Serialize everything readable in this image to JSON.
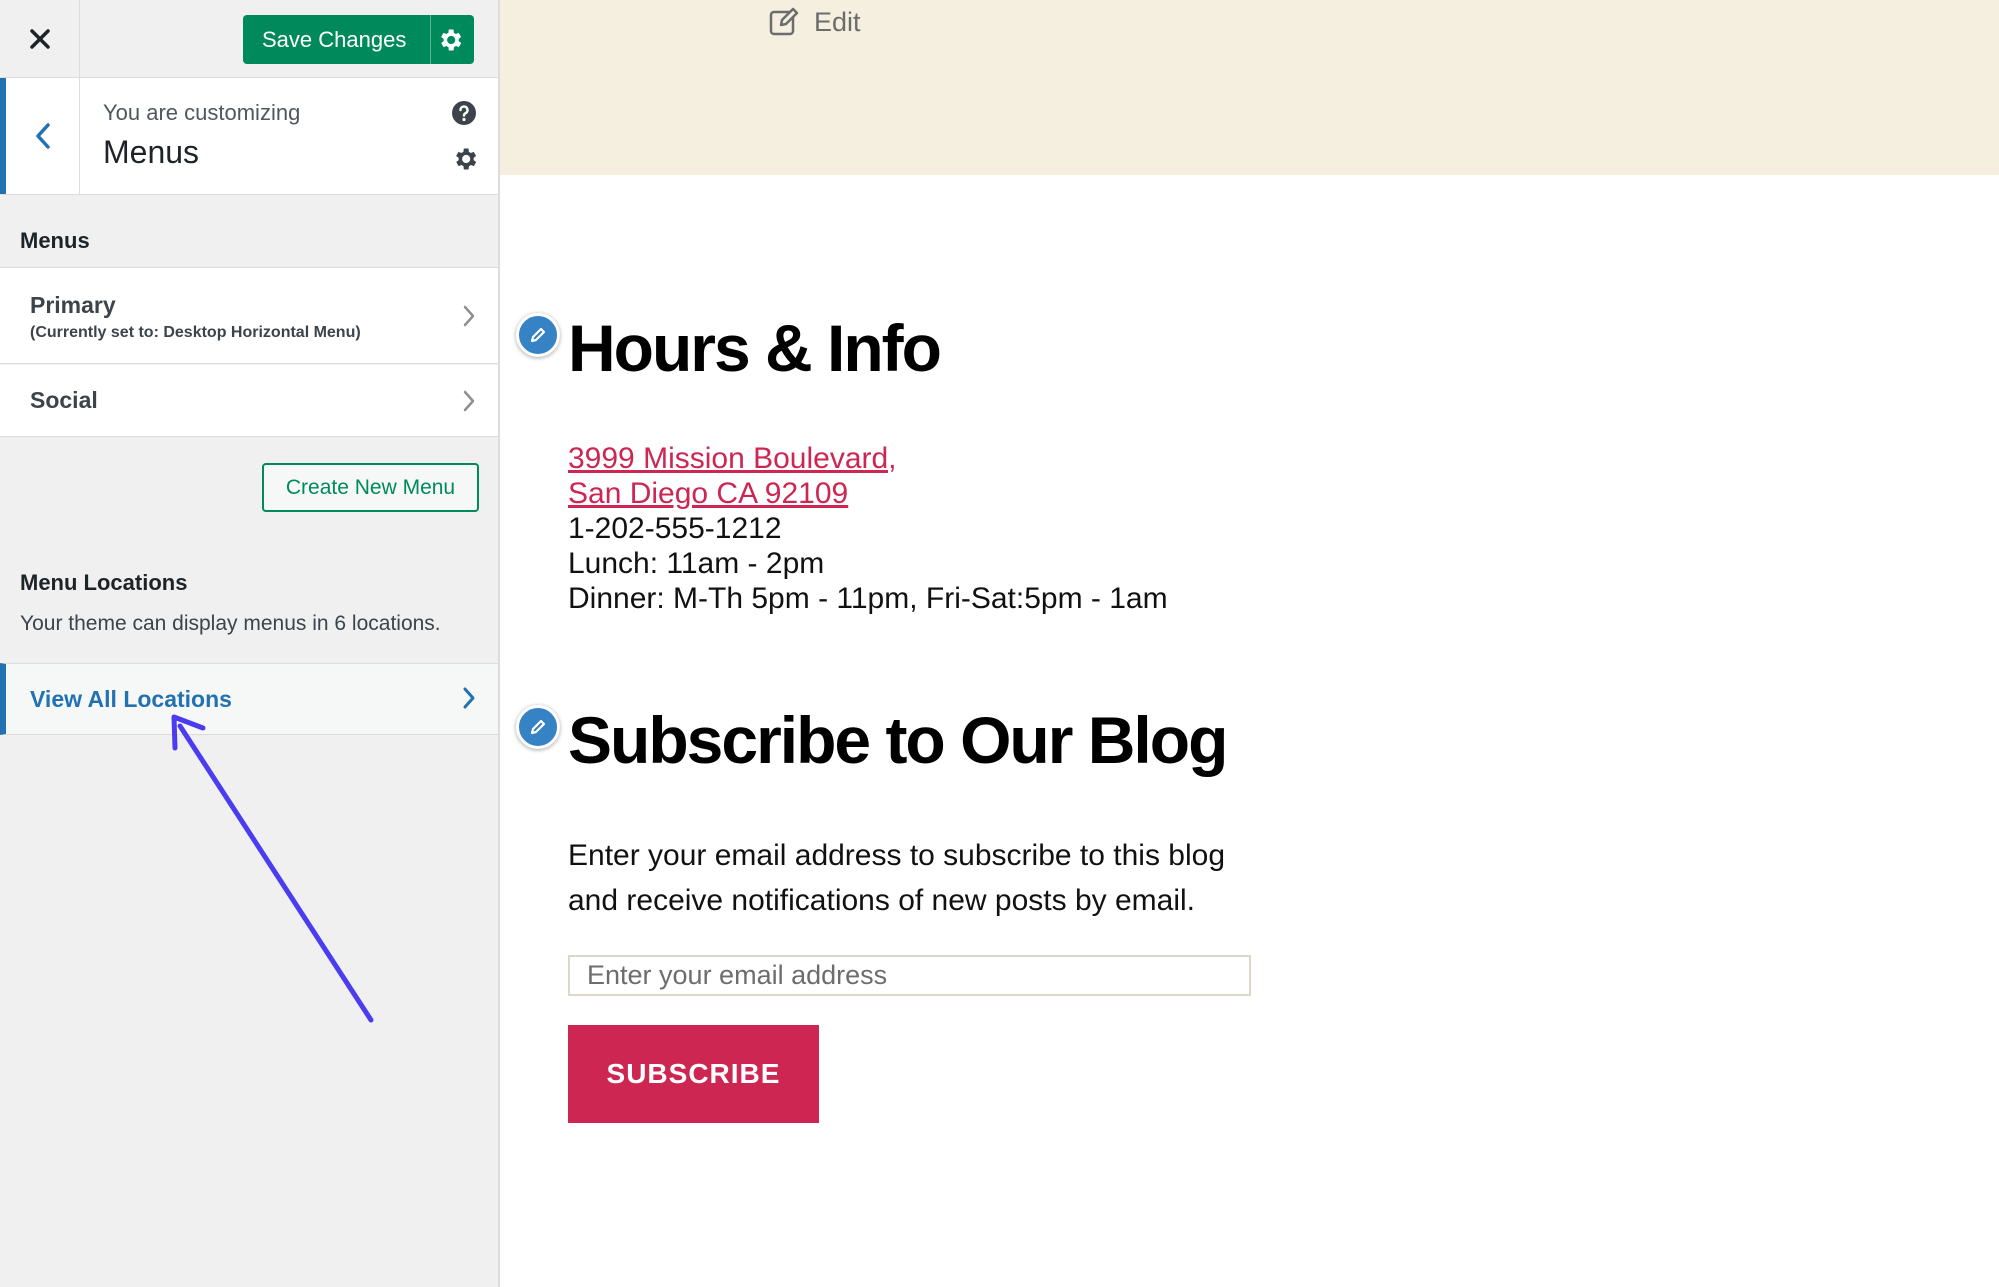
{
  "sidebar": {
    "close_icon": "close-icon",
    "save_label": "Save Changes",
    "customizing": {
      "pre": "You are customizing",
      "title": "Menus"
    },
    "menus_section_title": "Menus",
    "menus": [
      {
        "name": "Primary",
        "sub": "(Currently set to: Desktop Horizontal Menu)"
      },
      {
        "name": "Social",
        "sub": ""
      }
    ],
    "create_label": "Create New Menu",
    "locations_title": "Menu Locations",
    "locations_desc": "Your theme can display menus in 6 locations.",
    "view_all_label": "View All Locations",
    "colors": {
      "accent_green": "#008a5b",
      "accent_blue": "#2271b1",
      "annotation_arrow": "#4b3cf0"
    }
  },
  "preview": {
    "edit_label": "Edit",
    "hours_heading": "Hours & Info",
    "address_line1": "3999 Mission Boulevard,",
    "address_line2": "San Diego CA 92109",
    "phone": "1-202-555-1212",
    "lunch": "Lunch: 11am - 2pm",
    "dinner": "Dinner: M-Th 5pm - 11pm, Fri-Sat:5pm - 1am",
    "subscribe_heading": "Subscribe to Our Blog",
    "blurb": "Enter your email address to subscribe to this blog and receive notifications of new posts by email.",
    "email_placeholder": "Enter your email address",
    "subscribe_button": "SUBSCRIBE",
    "colors": {
      "header_band": "#f5efe0",
      "link": "#cd2653",
      "button": "#cd2653"
    }
  }
}
